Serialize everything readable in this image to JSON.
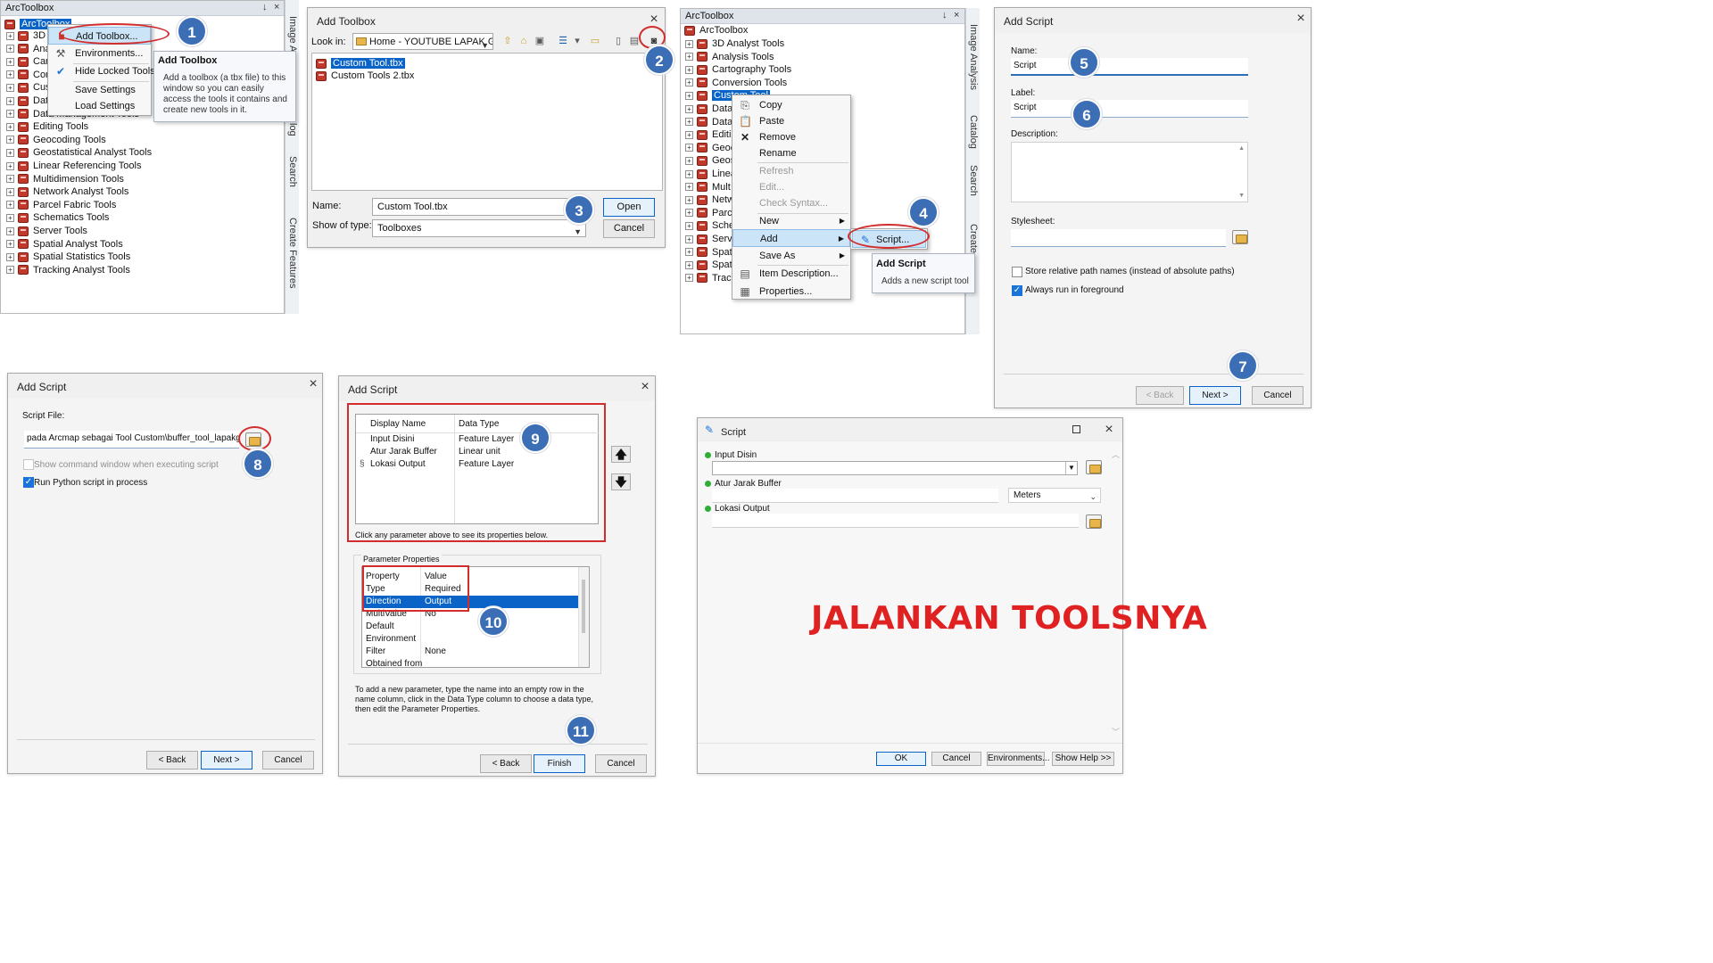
{
  "steps": [
    "1",
    "2",
    "3",
    "4",
    "5",
    "6",
    "7",
    "8",
    "9",
    "10",
    "11"
  ],
  "colors": {
    "badge": "#3b6eb5",
    "highlight": "#d22c2c",
    "selection": "#0a64c8",
    "caption": "#e02121"
  },
  "p1": {
    "title": "ArcToolbox",
    "pin": "↓",
    "close": "×",
    "root": "ArcToolbox",
    "items": [
      "3D A",
      "Ana",
      "Cart",
      "Con",
      "Cust",
      "Data",
      "Data Management Tools",
      "Editing Tools",
      "Geocoding Tools",
      "Geostatistical Analyst Tools",
      "Linear Referencing Tools",
      "Multidimension Tools",
      "Network Analyst Tools",
      "Parcel Fabric Tools",
      "Schematics Tools",
      "Server Tools",
      "Spatial Analyst Tools",
      "Spatial Statistics Tools",
      "Tracking Analyst Tools"
    ],
    "vtabs": [
      "Image A",
      "log",
      "Search",
      "Create Features"
    ],
    "menu": [
      "Add Toolbox...",
      "Environments...",
      "Hide Locked Tools",
      "Save Settings",
      "Load Settings"
    ],
    "tip_title": "Add Toolbox",
    "tip_text": "Add a toolbox (a tbx file) to this window so you can easily access the tools it contains and create new tools in it."
  },
  "p2": {
    "title": "Add Toolbox",
    "lookin_label": "Look in:",
    "lookin_value": "Home - YOUTUBE LAPAK GIS\\Me",
    "files": [
      "Custom Tool.tbx",
      "Custom Tools 2.tbx"
    ],
    "name_label": "Name:",
    "name_value": "Custom Tool.tbx",
    "type_label": "Show of type:",
    "type_value": "Toolboxes",
    "open": "Open",
    "cancel": "Cancel"
  },
  "p3": {
    "title": "ArcToolbox",
    "root": "ArcToolbox",
    "items": [
      "3D Analyst Tools",
      "Analysis Tools",
      "Cartography Tools",
      "Conversion Tools",
      "Custom Tool",
      "Data",
      "Data",
      "Editi",
      "Geoc",
      "Geos",
      "Linea",
      "Mult",
      "Netw",
      "Parc",
      "Sche",
      "Serve",
      "Spati",
      "Spati",
      "Tracl"
    ],
    "vtabs": [
      "Image Analysis",
      "Catalog",
      "Search",
      "Create"
    ],
    "menu": [
      "Copy",
      "Paste",
      "Remove",
      "Rename",
      "Refresh",
      "Edit...",
      "Check Syntax...",
      "New",
      "Add",
      "Save As",
      "Item Description...",
      "Properties..."
    ],
    "submenu": "Script...",
    "tip_title": "Add Script",
    "tip_text": "Adds a new script tool"
  },
  "p4": {
    "title": "Add Script",
    "name_label": "Name:",
    "name_value": "Script",
    "label_label": "Label:",
    "label_value": "Script",
    "desc_label": "Description:",
    "style_label": "Stylesheet:",
    "chk1": "Store relative path names (instead of absolute paths)",
    "chk2": "Always run in foreground",
    "back": "< Back",
    "next": "Next >",
    "cancel": "Cancel"
  },
  "p5": {
    "title": "Add Script",
    "file_label": "Script File:",
    "file_value": "pada Arcmap sebagai Tool Custom\\buffer_tool_lapakgis.py",
    "chk1": "Show command window when executing script",
    "chk2": "Run Python script in process",
    "back": "< Back",
    "next": "Next >",
    "cancel": "Cancel"
  },
  "p6": {
    "title": "Add Script",
    "col_display": "Display Name",
    "col_type": "Data Type",
    "rows": [
      {
        "name": "Input Disini",
        "type": "Feature Layer"
      },
      {
        "name": "Atur Jarak Buffer",
        "type": "Linear unit"
      },
      {
        "name": "Lokasi Output",
        "type": "Feature Layer"
      }
    ],
    "row_marker": "§",
    "hint": "Click any parameter above to see its properties below.",
    "props_group": "Parameter Properties",
    "prop_col": "Property",
    "val_col": "Value",
    "props": [
      {
        "p": "Type",
        "v": "Required"
      },
      {
        "p": "Direction",
        "v": "Output"
      },
      {
        "p": "MultiValue",
        "v": "No"
      },
      {
        "p": "Default",
        "v": ""
      },
      {
        "p": "Environment",
        "v": ""
      },
      {
        "p": "Filter",
        "v": "None"
      },
      {
        "p": "Obtained from",
        "v": ""
      }
    ],
    "instructions": "To add a new parameter, type the name into an empty row in the name column, click in the Data Type column to choose a data type, then edit the Parameter Properties.",
    "back": "< Back",
    "finish": "Finish",
    "cancel": "Cancel"
  },
  "p7": {
    "title": "Script",
    "param1": "Input Disin",
    "param2": "Atur Jarak Buffer",
    "unit": "Meters",
    "param3": "Lokasi Output",
    "ok": "OK",
    "cancel": "Cancel",
    "env": "Environments...",
    "help": "Show Help >>"
  },
  "caption": "JALANKAN TOOLSNYA"
}
